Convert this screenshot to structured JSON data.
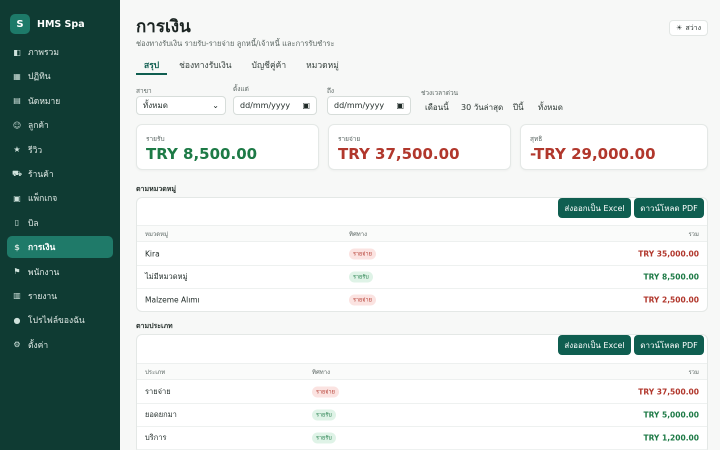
{
  "brand": {
    "logo_letter": "S",
    "name": "HMS Spa"
  },
  "sidebar": {
    "items": [
      {
        "icon": "dashboard-icon",
        "glyph": "◧",
        "label": "ภาพรวม"
      },
      {
        "icon": "calendar-icon",
        "glyph": "▦",
        "label": "ปฏิทิน"
      },
      {
        "icon": "appointment-icon",
        "glyph": "▤",
        "label": "นัดหมาย"
      },
      {
        "icon": "customer-icon",
        "glyph": "☺",
        "label": "ลูกค้า"
      },
      {
        "icon": "star-icon",
        "glyph": "★",
        "label": "รีวิว"
      },
      {
        "icon": "cart-icon",
        "glyph": "⛟",
        "label": "ร้านค้า"
      },
      {
        "icon": "package-icon",
        "glyph": "▣",
        "label": "แพ็กเกจ"
      },
      {
        "icon": "bill-icon",
        "glyph": "▯",
        "label": "บิล"
      },
      {
        "icon": "finance-icon",
        "glyph": "$",
        "label": "การเงิน",
        "active": true
      },
      {
        "icon": "flag-icon",
        "glyph": "⚑",
        "label": "พนักงาน"
      },
      {
        "icon": "report-icon",
        "glyph": "▥",
        "label": "รายงาน"
      },
      {
        "icon": "profile-icon",
        "glyph": "●",
        "label": "โปรไฟล์ของฉัน"
      },
      {
        "icon": "settings-icon",
        "glyph": "⚙",
        "label": "ตั้งค่า"
      }
    ]
  },
  "header": {
    "title": "การเงิน",
    "subtitle": "ช่องทางรับเงิน รายรับ-รายจ่าย ลูกหนี้/เจ้าหนี้ และการรับชำระ",
    "theme_glyph": "☀",
    "theme_label": "สว่าง"
  },
  "tabs": [
    {
      "label": "สรุป",
      "active": true
    },
    {
      "label": "ช่องทางรับเงิน"
    },
    {
      "label": "บัญชีคู่ค้า"
    },
    {
      "label": "หมวดหมู่"
    }
  ],
  "filters": {
    "branch_label": "สาขา",
    "branch_value": "ทั้งหมด",
    "from_label": "ตั้งแต่",
    "from_placeholder": "dd/mm/yyyy",
    "to_label": "ถึง",
    "to_placeholder": "dd/mm/yyyy",
    "quick_label": "ช่วงเวลาด่วน",
    "quick_options": [
      "เดือนนี้",
      "30 วันล่าสุด",
      "ปีนี้",
      "ทั้งหมด"
    ]
  },
  "stats": {
    "income": {
      "label": "รายรับ",
      "value": "TRY 8,500.00",
      "color": "#1d7a46"
    },
    "expense": {
      "label": "รายจ่าย",
      "value": "TRY 37,500.00",
      "color": "#b1372c"
    },
    "net": {
      "label": "สุทธิ",
      "value": "-TRY 29,000.00",
      "color": "#b1372c"
    }
  },
  "by_category": {
    "title": "ตามหมวดหมู่",
    "export_excel": "ส่งออกเป็น Excel",
    "download_pdf": "ดาวน์โหลด PDF",
    "columns": [
      "หมวดหมู่",
      "ทิศทาง",
      "รวม"
    ],
    "rows": [
      {
        "name": "Kira",
        "direction": "รายจ่าย",
        "type": "exp",
        "total": "TRY 35,000.00"
      },
      {
        "name": "ไม่มีหมวดหมู่",
        "direction": "รายรับ",
        "type": "inc",
        "total": "TRY 8,500.00"
      },
      {
        "name": "Malzeme Alımı",
        "direction": "รายจ่าย",
        "type": "exp",
        "total": "TRY 2,500.00"
      }
    ]
  },
  "by_type": {
    "title": "ตามประเภท",
    "export_excel": "ส่งออกเป็น Excel",
    "download_pdf": "ดาวน์โหลด PDF",
    "columns": [
      "ประเภท",
      "ทิศทาง",
      "รวม"
    ],
    "rows": [
      {
        "name": "รายจ่าย",
        "direction": "รายจ่าย",
        "type": "exp",
        "total": "TRY 37,500.00"
      },
      {
        "name": "ยอดยกมา",
        "direction": "รายรับ",
        "type": "inc",
        "total": "TRY 5,000.00"
      },
      {
        "name": "บริการ",
        "direction": "รายรับ",
        "type": "inc",
        "total": "TRY 1,200.00"
      }
    ]
  },
  "colors": {
    "accent": "#0f5e50",
    "sidebar": "#0f3b33",
    "income": "#1d7a46",
    "expense": "#b1372c"
  }
}
